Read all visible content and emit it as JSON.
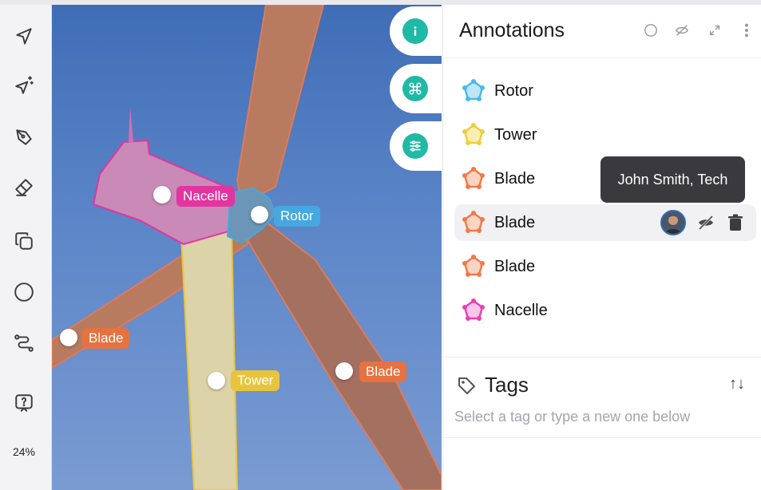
{
  "toolbar": {
    "tools": [
      "navigate-icon",
      "smart-select-icon",
      "pen-icon",
      "eraser-icon",
      "copy-icon",
      "circle-icon",
      "polyline-icon",
      "help-icon"
    ],
    "zoom": "24%"
  },
  "canvas": {
    "labels": [
      {
        "text": "Nacelle",
        "color": "#e2359f"
      },
      {
        "text": "Rotor",
        "color": "#45a8e0"
      },
      {
        "text": "Blade",
        "color": "#e57240"
      },
      {
        "text": "Tower",
        "color": "#e8c43d"
      },
      {
        "text": "Blade",
        "color": "#e57240"
      }
    ]
  },
  "side_buttons": [
    "info-icon",
    "command-icon",
    "settings-sliders-icon"
  ],
  "panel": {
    "title": "Annotations",
    "items": [
      {
        "label": "Rotor",
        "color": "#4bb9ea"
      },
      {
        "label": "Tower",
        "color": "#f0cd3d"
      },
      {
        "label": "Blade",
        "color": "#f07a48"
      },
      {
        "label": "Blade",
        "color": "#f07a48"
      },
      {
        "label": "Blade",
        "color": "#f07a48"
      },
      {
        "label": "Nacelle",
        "color": "#ec3fb4"
      }
    ],
    "tooltip": "John Smith, Tech",
    "tags": {
      "title": "Tags",
      "sort_icon": "↑↓",
      "placeholder": "Select a tag or type a new one below"
    }
  }
}
